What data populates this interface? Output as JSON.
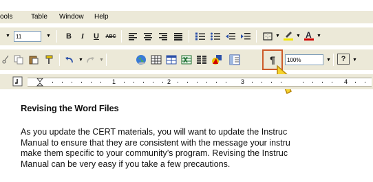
{
  "menu": {
    "items": [
      "ools",
      "Table",
      "Window",
      "Help"
    ]
  },
  "formatting": {
    "font_size": "11",
    "bold": "B",
    "italic": "I",
    "underline": "U",
    "strike": "ABC"
  },
  "standard": {
    "zoom": "100%",
    "help": "?",
    "show_hide": "¶"
  },
  "ruler": {
    "numbers": [
      "1",
      "2",
      "3",
      "4"
    ]
  },
  "document": {
    "heading": "Revising the Word Files",
    "lines": [
      "As you update the CERT materials, you will want to update the Instruc",
      "Manual to ensure that they are consistent with the message your instru",
      "make them specific to your community’s program.  Revising the Instruc",
      "Manual can be very easy if you take a few precautions."
    ]
  },
  "colors": {
    "highlight_border": "#cc5a29",
    "pointer_fill": "#f6d32d",
    "toolbar_bg": "#ece9d8"
  }
}
